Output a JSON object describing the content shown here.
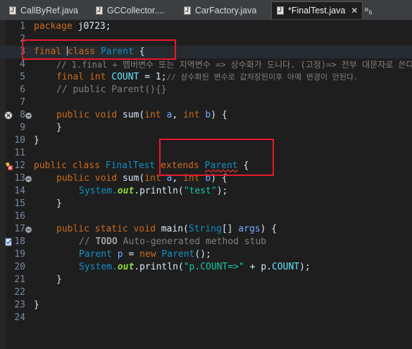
{
  "tabs": [
    {
      "label": "CallByRef.java",
      "active": false
    },
    {
      "label": "GCCollector....",
      "active": false
    },
    {
      "label": "CarFactory.java",
      "active": false
    },
    {
      "label": "*FinalTest.java",
      "active": true
    }
  ],
  "tab_overflow": {
    "symbol": "»",
    "count": "6"
  },
  "close_symbol": "✕",
  "line_numbers": [
    "1",
    "2",
    "3",
    "4",
    "5",
    "6",
    "7",
    "8",
    "9",
    "10",
    "11",
    "12",
    "13",
    "14",
    "15",
    "16",
    "17",
    "18",
    "19",
    "20",
    "21",
    "22",
    "23",
    "24"
  ],
  "code": {
    "l1": {
      "kw": "package",
      "rest": " j0723;"
    },
    "l3": {
      "kw": "final",
      "kw2": "class",
      "cls": "Parent",
      "rest": " {"
    },
    "l4": {
      "comment": "// 1.final + 멤버변수 또는 지역변수 => 상수화가 도니다. (고정)=> 전부 대문자로 쓴다"
    },
    "l5": {
      "kw1": "final",
      "kw2": "int",
      "name": "COUNT",
      "eq": " = ",
      "val": "1",
      "semi": ";",
      "comment": "// 상수화된 변수로 값저장된이후 아예 변경이 안된다."
    },
    "l6": {
      "comment": "// public Parent(){}"
    },
    "l8": {
      "kw1": "public",
      "kw2": "void",
      "name": "sum",
      "p1": "(",
      "kw3": "int",
      "a": " a",
      "comma": ", ",
      "kw4": "int",
      "b": " b",
      "rest": ") {"
    },
    "l9": {
      "text": "}"
    },
    "l10": {
      "text": "}"
    },
    "l12": {
      "kw1": "public",
      "kw2": "class",
      "cls": "FinalTest",
      "kw3": "extends",
      "parent": "Parent",
      "rest": " {"
    },
    "l13": {
      "kw1": "public",
      "kw2": "void",
      "name": "sum",
      "p1": "(",
      "kw3": "int",
      "a": " a",
      "comma": ", ",
      "kw4": "int",
      "b": " b",
      "rest": ") {"
    },
    "l14": {
      "sys": "System.",
      "out": "out",
      "call": ".println(",
      "str": "\"test\"",
      "end": ");"
    },
    "l15": {
      "text": "}"
    },
    "l17": {
      "kw1": "public",
      "kw2": "static",
      "kw3": "void",
      "name": "main",
      "p1": "(",
      "type": "String",
      "arr": "[] ",
      "arg": "args",
      "rest": ") {"
    },
    "l18": {
      "c1": "// ",
      "todo": "TODO",
      "c2": " Auto-generated method stub"
    },
    "l19": {
      "type": "Parent",
      "var": " p",
      "eq": " = ",
      "kw": "new",
      "type2": " Parent",
      "rest": "();"
    },
    "l20": {
      "sys": "System.",
      "out": "out",
      "call": ".println(",
      "str": "\"p.COUNT=>\"",
      "plus": " + ",
      "obj": "p.",
      "fld": "COUNT",
      "end": ");"
    },
    "l21": {
      "text": "}"
    },
    "l23": {
      "text": "}"
    }
  },
  "colors": {
    "annotation": "#e8192c",
    "keyword": "#cc6c1d",
    "type": "#1290c3",
    "string": "#17c6a3",
    "comment": "#808080"
  }
}
